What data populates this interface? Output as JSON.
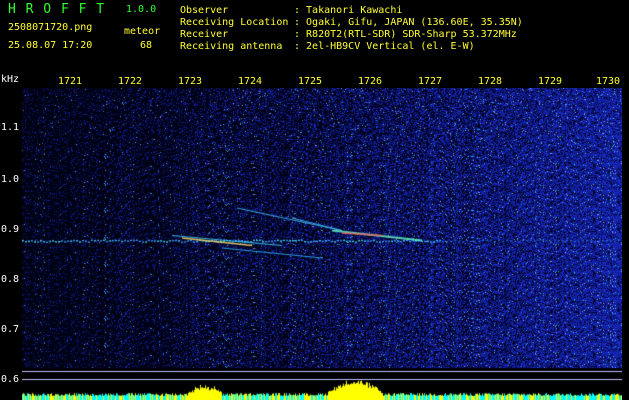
{
  "app": {
    "title": "H R O F F T",
    "version": "1.0.0",
    "file": "2508071720.png",
    "datetime": "25.08.07 17:20",
    "meteor_label": "meteor",
    "meteor_count": "68"
  },
  "info": {
    "rows": [
      {
        "label": "Observer",
        "value": ": Takanori Kawachi"
      },
      {
        "label": "Receiving Location",
        "value": ": Ogaki, Gifu, JAPAN (136.60E, 35.35N)"
      },
      {
        "label": "Receiver",
        "value": ": R820T2(RTL-SDR) SDR-Sharp 53.372MHz"
      },
      {
        "label": "Receiving antenna",
        "value": ": 2el-HB9CV Vertical (el. E-W)"
      }
    ]
  },
  "axis": {
    "y_unit": "kHz",
    "y_ticks": [
      "1.1",
      "1.0",
      "0.9",
      "0.8",
      "0.7",
      "0.6"
    ],
    "x_ticks": [
      "1721",
      "1722",
      "1723",
      "1724",
      "1725",
      "1726",
      "1727",
      "1728",
      "1729",
      "1730"
    ]
  },
  "colors": {
    "background": "#000000",
    "label_green": "#2fff2f",
    "label_yellow": "#ffff33",
    "noise_blue": "#3040c0",
    "signal_cyan": "#40e0ff",
    "level_yellow": "#ffff00"
  }
}
